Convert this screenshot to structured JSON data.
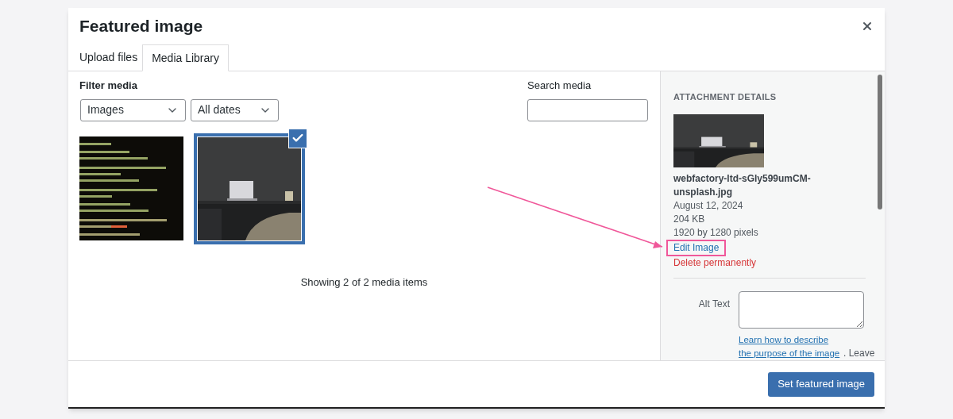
{
  "dialog": {
    "title": "Featured image"
  },
  "tabs": [
    {
      "label": "Upload files",
      "selected": false
    },
    {
      "label": "Media Library",
      "selected": true
    }
  ],
  "filter": {
    "label": "Filter media",
    "selects": [
      {
        "value": "Images"
      },
      {
        "value": "All dates"
      }
    ]
  },
  "search": {
    "label": "Search media"
  },
  "media_items": [
    {
      "kind": "code",
      "selected": false
    },
    {
      "kind": "desk",
      "selected": true
    }
  ],
  "status": "Showing 2 of 2 media items",
  "details": {
    "heading": "ATTACHMENT DETAILS",
    "filename": "webfactory-ltd-sGly599umCM-unsplash.jpg",
    "date": "August 12, 2024",
    "size": "204 KB",
    "dimensions": "1920 by 1280 pixels",
    "edit_link": {
      "label": "Edit Image",
      "highlighted": true
    },
    "delete_link": "Delete permanently",
    "alt_text": {
      "label": "Alt Text",
      "help_link": "Learn how to describe the purpose of the image",
      "help_rest": ". Leave"
    }
  },
  "footer": {
    "button": "Set featured image"
  }
}
